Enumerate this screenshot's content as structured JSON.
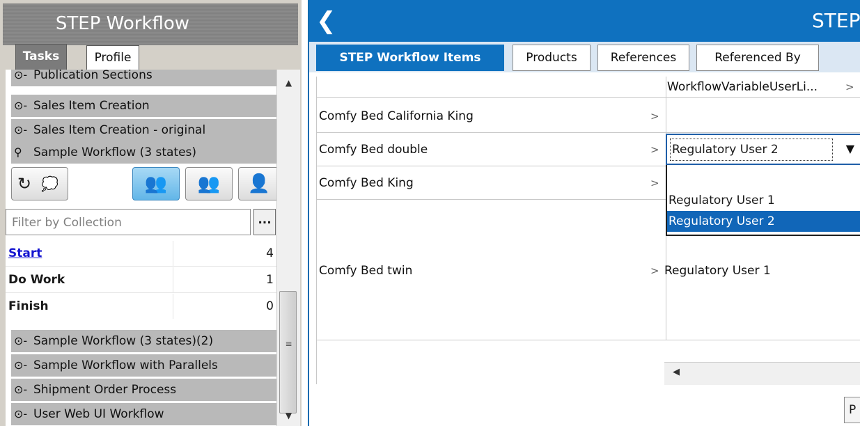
{
  "left": {
    "title": "STEP Workflow",
    "tabs": [
      {
        "label": "Tasks",
        "active": true
      },
      {
        "label": "Profile",
        "active": false
      }
    ],
    "workflows_top": [
      {
        "label": "Publication Sections",
        "icon": "workflow-collapsed-icon"
      },
      {
        "label": "Sales Item Creation",
        "icon": "workflow-collapsed-icon"
      },
      {
        "label": "Sales Item Creation - original",
        "icon": "workflow-collapsed-icon"
      },
      {
        "label": "Sample Workflow (3 states)",
        "icon": "workflow-expanded-icon"
      }
    ],
    "filter_placeholder": "Filter by Collection",
    "filter_button": "...",
    "states": [
      {
        "name": "Start",
        "count": "4",
        "link": true
      },
      {
        "name": "Do Work",
        "count": "1",
        "link": false
      },
      {
        "name": "Finish",
        "count": "0",
        "link": false
      }
    ],
    "workflows_bottom": [
      {
        "label": "Sample Workflow (3 states)(2)",
        "icon": "workflow-collapsed-icon"
      },
      {
        "label": "Sample Workflow with Parallels",
        "icon": "workflow-collapsed-icon"
      },
      {
        "label": "Shipment Order Process",
        "icon": "workflow-collapsed-icon"
      },
      {
        "label": "User Web UI Workflow",
        "icon": "workflow-collapsed-icon"
      }
    ]
  },
  "right": {
    "title": "STEP",
    "tabs": [
      {
        "label": "STEP Workflow Items",
        "active": true
      },
      {
        "label": "Products",
        "active": false
      },
      {
        "label": "References",
        "active": false
      },
      {
        "label": "Referenced By",
        "active": false
      }
    ],
    "column_header": "WorkflowVariableUserLi...",
    "rows": [
      {
        "name": "Comfy Bed California King",
        "value": ""
      },
      {
        "name": "Comfy Bed double",
        "value": "Regulatory User 2"
      },
      {
        "name": "Comfy Bed King",
        "value": ""
      },
      {
        "name": "Comfy Bed twin",
        "value": "Regulatory User 1"
      }
    ],
    "dropdown_options": [
      {
        "label": "",
        "selected": false
      },
      {
        "label": "Regulatory User 1",
        "selected": false
      },
      {
        "label": "Regulatory User 2",
        "selected": true
      }
    ],
    "bottom_button": "P"
  }
}
